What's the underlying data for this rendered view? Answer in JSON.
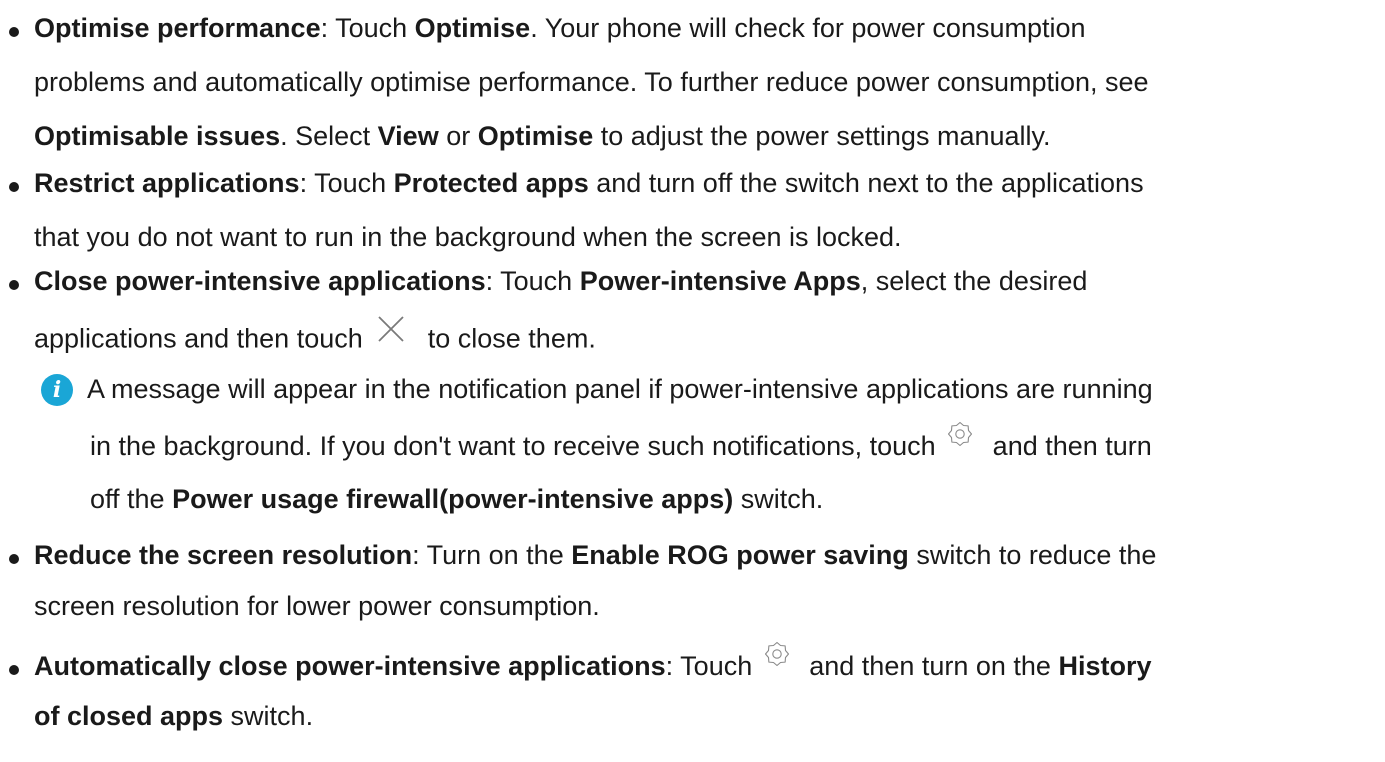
{
  "items": [
    {
      "lines": [
        [
          {
            "t": "Optimise performance",
            "b": true
          },
          {
            "t": ": Touch "
          },
          {
            "t": "Optimise",
            "b": true
          },
          {
            "t": ". Your phone will check for power consumption"
          }
        ],
        [
          {
            "t": "problems and automatically optimise performance. To further reduce power consumption, see"
          }
        ],
        [
          {
            "t": "Optimisable issues",
            "b": true
          },
          {
            "t": ". Select "
          },
          {
            "t": "View",
            "b": true
          },
          {
            "t": " or "
          },
          {
            "t": "Optimise",
            "b": true
          },
          {
            "t": " to adjust the power settings manually."
          }
        ]
      ]
    },
    {
      "lines": [
        [
          {
            "t": "Restrict applications",
            "b": true
          },
          {
            "t": ": Touch "
          },
          {
            "t": "Protected apps",
            "b": true
          },
          {
            "t": " and turn off the switch next to the applications"
          }
        ],
        [
          {
            "t": "that you do not want to run in the background when the screen is locked."
          }
        ]
      ]
    },
    {
      "lines": [
        [
          {
            "t": "Close power-intensive applications",
            "b": true
          },
          {
            "t": ": Touch "
          },
          {
            "t": "Power-intensive Apps",
            "b": true
          },
          {
            "t": ", select the desired"
          }
        ],
        [
          {
            "t": "applications and then touch "
          },
          {
            "icon": "close-icon"
          },
          {
            "t": " to close them."
          }
        ]
      ]
    },
    {
      "lines": [
        [
          {
            "t": "Reduce the screen resolution",
            "b": true
          },
          {
            "t": ": Turn on the "
          },
          {
            "t": "Enable ROG power saving",
            "b": true
          },
          {
            "t": " switch to reduce the"
          }
        ],
        [
          {
            "t": "screen resolution for lower power consumption."
          }
        ]
      ]
    },
    {
      "lines": [
        [
          {
            "t": "Automatically close power-intensive applications",
            "b": true
          },
          {
            "t": ": Touch "
          },
          {
            "icon": "gear-icon"
          },
          {
            "t": " and then turn on the "
          },
          {
            "t": "History",
            "b": true
          }
        ],
        [
          {
            "t": "of closed apps",
            "b": true
          },
          {
            "t": " switch."
          }
        ]
      ]
    }
  ],
  "note": {
    "icon": "info-icon",
    "icon_glyph": "i",
    "icon_color": "#1aa6d6",
    "lines": [
      [
        {
          "t": "A message will appear in the notification panel if power-intensive applications are running"
        }
      ],
      [
        {
          "t": "in the background. If you don't want to receive such notifications, touch "
        },
        {
          "icon": "gear-icon"
        },
        {
          "t": " and then turn"
        }
      ],
      [
        {
          "t": "off the "
        },
        {
          "t": "Power usage firewall(power-intensive apps)",
          "b": true
        },
        {
          "t": " switch."
        }
      ]
    ]
  }
}
